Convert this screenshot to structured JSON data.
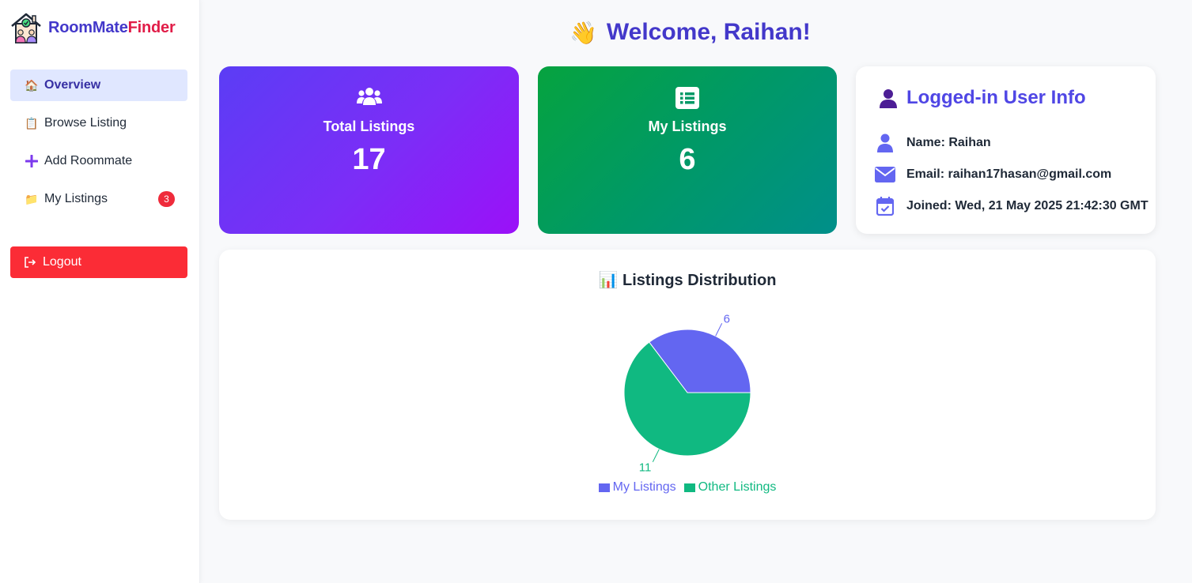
{
  "brand": {
    "part1": "RoomMate",
    "part2": "Finder"
  },
  "nav": {
    "items": [
      {
        "label": "Overview",
        "icon": "house-emoji",
        "active": true
      },
      {
        "label": "Browse Listing",
        "icon": "clipboard-emoji"
      },
      {
        "label": "Add Roommate",
        "icon": "plus-icon"
      },
      {
        "label": "My Listings",
        "icon": "folder-emoji",
        "badge": "3"
      }
    ],
    "logout_label": "Logout"
  },
  "header": {
    "wave": "👋",
    "title": "Welcome, Raihan!"
  },
  "stats": [
    {
      "label": "Total Listings",
      "value": "17",
      "icon": "users-icon"
    },
    {
      "label": "My Listings",
      "value": "6",
      "icon": "list-icon"
    }
  ],
  "user_info": {
    "title": "Logged-in User Info",
    "name": "Name: Raihan",
    "email": "Email: raihan17hasan@gmail.com",
    "joined": "Joined: Wed, 21 May 2025 21:42:30 GMT"
  },
  "colors": {
    "accent": "#4338ca",
    "my_listings": "#6366f1",
    "other_listings": "#10b981",
    "logout": "#fb2c36"
  },
  "chart_data": {
    "type": "pie",
    "title": "📊 Listings Distribution",
    "categories": [
      "My Listings",
      "Other Listings"
    ],
    "values": [
      6,
      11
    ],
    "colors": [
      "#6366f1",
      "#10b981"
    ],
    "legend": "bottom"
  }
}
